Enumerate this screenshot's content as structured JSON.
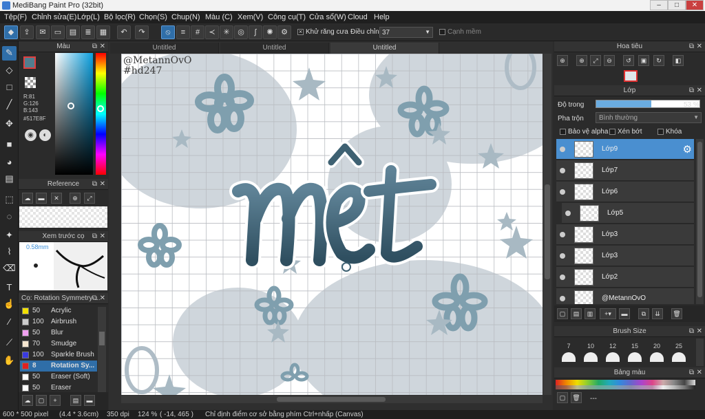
{
  "window": {
    "title": "MediBang Paint Pro (32bit)",
    "min": "–",
    "max": "□",
    "close": "✕"
  },
  "menu": [
    "Tệp(F)",
    "Chỉnh sửa(E)",
    "Lớp(L)",
    "Bộ lọc(R)",
    "Chọn(S)",
    "Chup(N)",
    "Màu (C)",
    "Xem(V)",
    "Công cụ(T)",
    "Cửa sổ(W)",
    "Cloud",
    "Help"
  ],
  "toolbar": {
    "antialias_label": "Khử răng cưa",
    "adjust_label": "Điều chỉnh",
    "adjust_value": "37",
    "edge_label": "Cạnh mềm"
  },
  "color_panel": {
    "title": "Màu",
    "r": "R:81",
    "g": "G:126",
    "b": "B:143",
    "hex": "#517E8F",
    "current_color": "#517E8F"
  },
  "reference_panel": {
    "title": "Reference"
  },
  "brush_preview": {
    "title": "Xem trước cọ",
    "size": "0.58mm"
  },
  "brush_list": {
    "title": "Cọ: Rotation Symmetry ...",
    "items": [
      {
        "num": "50",
        "name": "Acrylic",
        "color": "#f2e000"
      },
      {
        "num": "100",
        "name": "Airbrush",
        "color": "#cccccc"
      },
      {
        "num": "50",
        "name": "Blur",
        "color": "#f0a0f0"
      },
      {
        "num": "70",
        "name": "Smudge",
        "color": "#f5e6d0"
      },
      {
        "num": "100",
        "name": "Sparkle Brush",
        "color": "#3a3ae0"
      },
      {
        "num": "8",
        "name": "Rotation Sy...",
        "color": "#e02020"
      },
      {
        "num": "50",
        "name": "Eraser (Soft)",
        "color": "#ffffff"
      },
      {
        "num": "50",
        "name": "Eraser",
        "color": "#ffffff"
      }
    ]
  },
  "tabs": [
    "Untitled",
    "Untitled",
    "Untitled"
  ],
  "canvas": {
    "watermark1": "@MetannOvO",
    "watermark2": "#hd247",
    "art_text": "mệt"
  },
  "navigator": {
    "title": "Hoa tiêu"
  },
  "layers": {
    "title": "Lớp",
    "opacity_label": "Độ trong",
    "opacity_value": "53 %",
    "opacity_percent": 53,
    "blend_label": "Pha trộn",
    "blend_value": "Bình thường",
    "protect_alpha": "Bảo vệ alpha",
    "clip": "Xén bớt",
    "lock": "Khóa",
    "items": [
      {
        "name": "Lớp9",
        "selected": true
      },
      {
        "name": "Lớp7"
      },
      {
        "name": "Lớp6"
      },
      {
        "name": "Lớp5"
      },
      {
        "name": "Lớp3"
      },
      {
        "name": "Lớp3"
      },
      {
        "name": "Lớp2"
      },
      {
        "name": "@MetannOvO"
      }
    ]
  },
  "brush_size": {
    "title": "Brush Size",
    "sizes": [
      "7",
      "10",
      "12",
      "15",
      "20",
      "25"
    ]
  },
  "palette": {
    "title": "Bảng màu",
    "dashes": "---"
  },
  "status": {
    "size": "600 * 500 pixel",
    "cm": "(4.4 * 3.6cm)",
    "dpi": "350 dpi",
    "zoom": "124 %",
    "coords": "( -14, 465 )",
    "hint": "Chỉ định điểm cơ sở bằng phím Ctrl+nhấp (Canvas)"
  }
}
